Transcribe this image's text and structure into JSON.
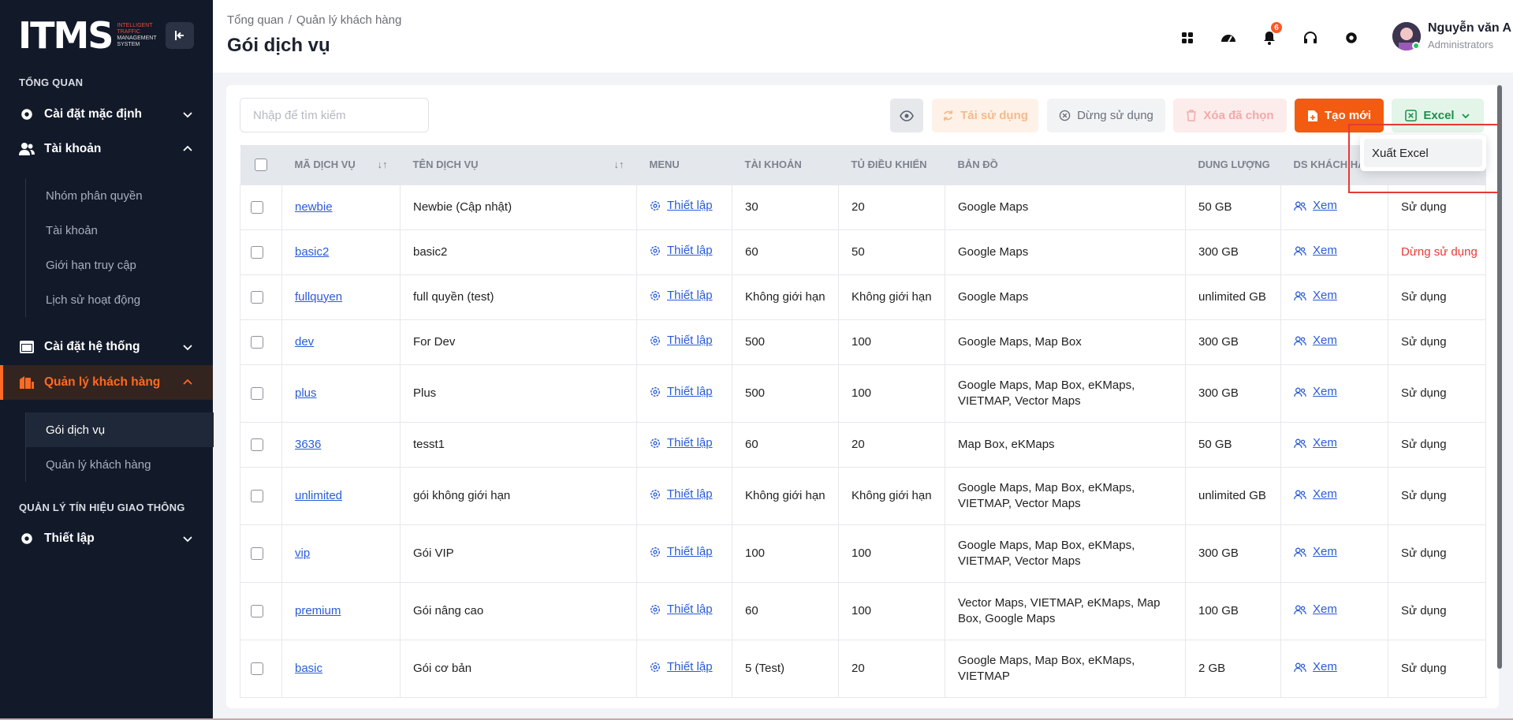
{
  "logo": {
    "main": "ITMS",
    "sub": [
      "INTELLIGENT",
      "TRAFFIC",
      "MANAGEMENT",
      "SYSTEM"
    ]
  },
  "sidebar": {
    "section_overview": "TỔNG QUAN",
    "items": [
      {
        "label": "Cài đặt mặc định",
        "icon": "gear-icon"
      },
      {
        "label": "Tài khoản",
        "icon": "users-icon"
      },
      {
        "label": "Cài đặt hệ thống",
        "icon": "window-icon"
      },
      {
        "label": "Quản lý khách hàng",
        "icon": "building-icon"
      },
      {
        "label": "Thiết lập",
        "icon": "gear-icon"
      }
    ],
    "account_sub": [
      "Nhóm phân quyền",
      "Tài khoản",
      "Giới hạn truy cập",
      "Lịch sử hoạt động"
    ],
    "customer_sub": [
      "Gói dịch vụ",
      "Quản lý khách hàng"
    ],
    "section_traffic": "QUẢN LÝ TÍN HIỆU GIAO THÔNG"
  },
  "header": {
    "breadcrumb": [
      "Tổng quan",
      "Quản lý khách hàng"
    ],
    "breadcrumb_sep": "/",
    "title": "Gói dịch vụ",
    "notification_count": "6",
    "user_name": "Nguyễn văn A",
    "user_role": "Administrators"
  },
  "toolbar": {
    "search_placeholder": "Nhập để tìm kiếm",
    "reuse": "Tái sử dụng",
    "stop": "Dừng sử dụng",
    "delete": "Xóa đã chọn",
    "create": "Tạo mới",
    "excel": "Excel"
  },
  "dropdown": {
    "export": "Xuất Excel"
  },
  "table": {
    "headers": [
      "MÃ DỊCH VỤ",
      "TÊN DỊCH VỤ",
      "MENU",
      "TÀI KHOẢN",
      "TỦ ĐIỀU KHIỂN",
      "BẢN ĐỒ",
      "DUNG LƯỢNG",
      "DS KHÁCH HÀNG",
      ""
    ],
    "action_label": "Thiết lập",
    "view_label": "Xem",
    "rows": [
      {
        "code": "newbie",
        "name": "Newbie (Cập nhật)",
        "accounts": "30",
        "controllers": "20",
        "maps": "Google Maps",
        "storage": "50 GB",
        "status": "Sử dụng",
        "stopped": false
      },
      {
        "code": "basic2",
        "name": "basic2",
        "accounts": "60",
        "controllers": "50",
        "maps": "Google Maps",
        "storage": "300 GB",
        "status": "Dừng sử dụng",
        "stopped": true
      },
      {
        "code": "fullquyen",
        "name": "full quyền (test)",
        "accounts": "Không giới hạn",
        "controllers": "Không giới hạn",
        "maps": "Google Maps",
        "storage": "unlimited GB",
        "status": "Sử dụng",
        "stopped": false
      },
      {
        "code": "dev",
        "name": "For Dev",
        "accounts": "500",
        "controllers": "100",
        "maps": "Google Maps, Map Box",
        "storage": "300 GB",
        "status": "Sử dụng",
        "stopped": false
      },
      {
        "code": "plus",
        "name": "Plus",
        "accounts": "500",
        "controllers": "100",
        "maps": "Google Maps, Map Box, eKMaps, VIETMAP, Vector Maps",
        "storage": "300 GB",
        "status": "Sử dụng",
        "stopped": false
      },
      {
        "code": "3636",
        "name": "tesst1",
        "accounts": "60",
        "controllers": "20",
        "maps": "Map Box, eKMaps",
        "storage": "50 GB",
        "status": "Sử dụng",
        "stopped": false
      },
      {
        "code": "unlimited",
        "name": "gói không giới hạn",
        "accounts": "Không giới hạn",
        "controllers": "Không giới hạn",
        "maps": "Google Maps, Map Box, eKMaps, VIETMAP, Vector Maps",
        "storage": "unlimited GB",
        "status": "Sử dụng",
        "stopped": false
      },
      {
        "code": "vip",
        "name": "Gói VIP",
        "accounts": "100",
        "controllers": "100",
        "maps": "Google Maps, Map Box, eKMaps, VIETMAP, Vector Maps",
        "storage": "300 GB",
        "status": "Sử dụng",
        "stopped": false
      },
      {
        "code": "premium",
        "name": "Gói nâng cao",
        "accounts": "60",
        "controllers": "100",
        "maps": "Vector Maps, VIETMAP, eKMaps, Map Box, Google Maps",
        "storage": "100 GB",
        "status": "Sử dụng",
        "stopped": false
      },
      {
        "code": "basic",
        "name": "Gói cơ bản",
        "accounts": "5 (Test)",
        "controllers": "20",
        "maps": "Google Maps, Map Box, eKMaps, VIETMAP",
        "storage": "2 GB",
        "status": "Sử dụng",
        "stopped": false
      }
    ]
  },
  "colors": {
    "accent": "#f35b10",
    "sidebar_bg": "#121a2a",
    "link": "#2a5bd7",
    "danger": "#e53935",
    "excel_green": "#1e8f4a"
  }
}
